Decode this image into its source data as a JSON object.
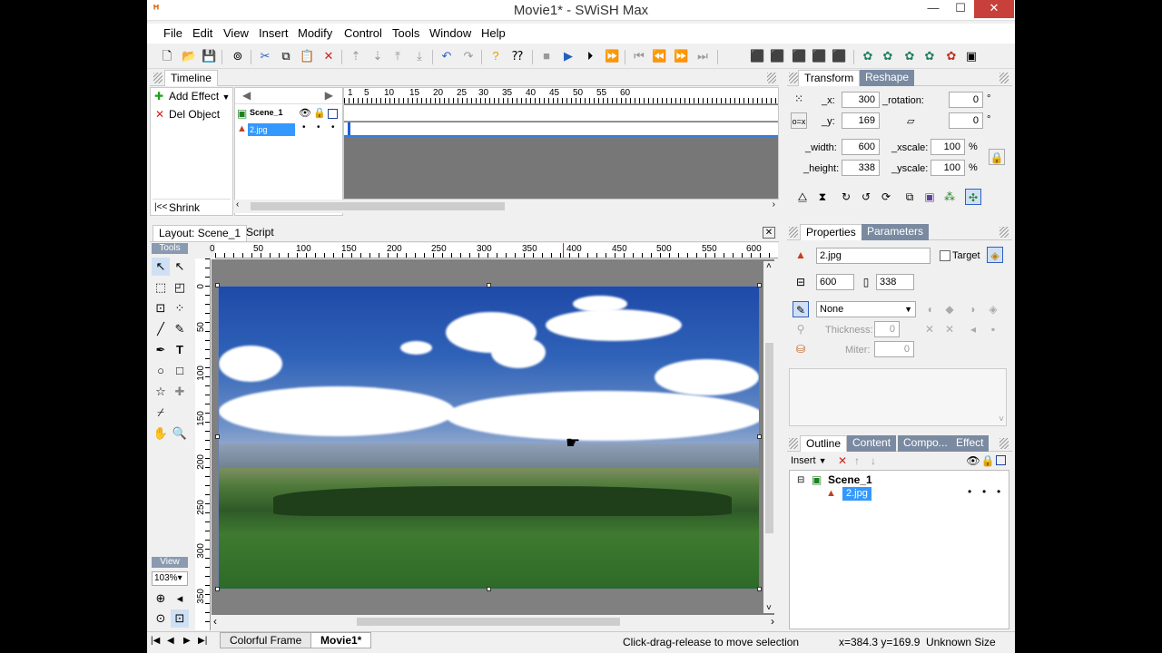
{
  "window": {
    "title": "Movie1* - SWiSH Max",
    "minimize": "—",
    "maximize": "☐",
    "close": "✕"
  },
  "menu": [
    "File",
    "Edit",
    "View",
    "Insert",
    "Modify",
    "Control",
    "Tools",
    "Window",
    "Help"
  ],
  "timeline": {
    "tab": "Timeline",
    "add_effect": "Add Effect",
    "del_object": "Del Object",
    "shrink": "Shrink",
    "scene": "Scene_1",
    "layer": "2.jpg",
    "ticks": [
      "1",
      "5",
      "10",
      "15",
      "20",
      "25",
      "30",
      "35",
      "40",
      "45",
      "50",
      "55",
      "60"
    ]
  },
  "layout": {
    "tab_layout": "Layout: Scene_1",
    "tab_script": "Script",
    "tools_label": "Tools",
    "view_label": "View",
    "zoom": "103%",
    "hruler": [
      "0",
      "50",
      "100",
      "150",
      "200",
      "250",
      "300",
      "350",
      "400",
      "450",
      "500",
      "550",
      "600"
    ],
    "vruler": [
      "0",
      "50",
      "100",
      "150",
      "200",
      "250",
      "300",
      "350"
    ]
  },
  "transform": {
    "tab": "Transform",
    "tab2": "Reshape",
    "x_label": "_x:",
    "x": "300",
    "y_label": "_y:",
    "y": "169",
    "rotation_label": "_rotation:",
    "rotation": "0",
    "skew": "0",
    "width_label": "_width:",
    "width": "600",
    "height_label": "_height:",
    "height": "338",
    "xscale_label": "_xscale:",
    "xscale": "100",
    "yscale_label": "_yscale:",
    "yscale": "100",
    "deg": "°",
    "pct": "%"
  },
  "properties": {
    "tab": "Properties",
    "tab2": "Parameters",
    "name": "2.jpg",
    "target": "Target",
    "w": "600",
    "h": "338",
    "line": "None",
    "thickness_label": "Thickness:",
    "thickness": "0",
    "miter_label": "Miter:",
    "miter": "0"
  },
  "outline": {
    "tabs": [
      "Outline",
      "Content",
      "Compo...",
      "Effect"
    ],
    "insert": "Insert",
    "scene": "Scene_1",
    "item": "2.jpg"
  },
  "bottom": {
    "tab1": "Colorful Frame",
    "tab2": "Movie1*",
    "status": "Click-drag-release to move selection",
    "coords": "x=384.3 y=169.9",
    "size": "Unknown Size"
  }
}
